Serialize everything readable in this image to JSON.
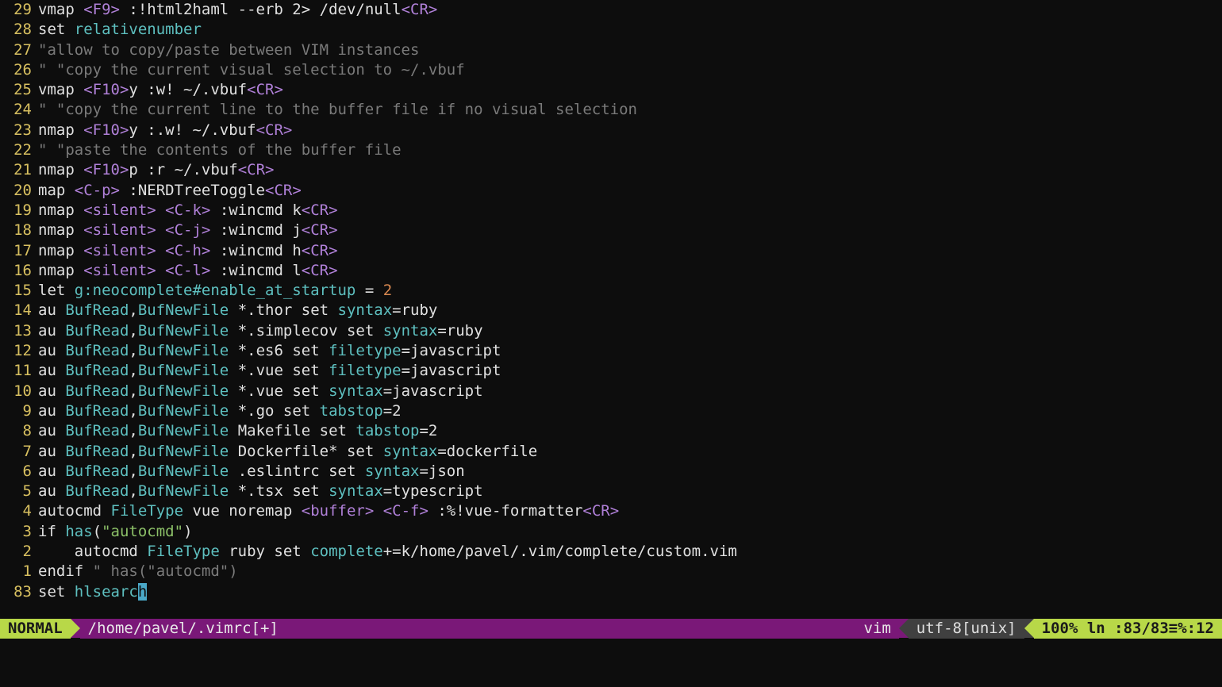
{
  "lines": [
    {
      "n": "29",
      "html": "vmap <span class='purple'>&lt;F9&gt;</span> :!html2haml --erb 2&gt; /dev/null<span class='purple'>&lt;CR&gt;</span>"
    },
    {
      "n": "28",
      "html": "set <span class='cyan'>relativenumber</span>"
    },
    {
      "n": "27",
      "html": "<span class='gray'>\"allow to copy/paste between VIM instances</span>"
    },
    {
      "n": "26",
      "html": "<span class='gray'>\" \"copy the current visual selection to ~/.vbuf</span>"
    },
    {
      "n": "25",
      "html": "vmap <span class='purple'>&lt;F10&gt;</span>y :w! ~/.vbuf<span class='purple'>&lt;CR&gt;</span>"
    },
    {
      "n": "24",
      "html": "<span class='gray'>\" \"copy the current line to the buffer file if no visual selection</span>"
    },
    {
      "n": "23",
      "html": "nmap <span class='purple'>&lt;F10&gt;</span>y :.w! ~/.vbuf<span class='purple'>&lt;CR&gt;</span>"
    },
    {
      "n": "22",
      "html": "<span class='gray'>\" \"paste the contents of the buffer file</span>"
    },
    {
      "n": "21",
      "html": "nmap <span class='purple'>&lt;F10&gt;</span>p :r ~/.vbuf<span class='purple'>&lt;CR&gt;</span>"
    },
    {
      "n": "20",
      "html": "map <span class='purple'>&lt;C-p&gt;</span> :NERDTreeToggle<span class='purple'>&lt;CR&gt;</span>"
    },
    {
      "n": "19",
      "html": "nmap <span class='purple'>&lt;silent&gt;</span> <span class='purple'>&lt;C-k&gt;</span> :wincmd k<span class='purple'>&lt;CR&gt;</span>"
    },
    {
      "n": "18",
      "html": "nmap <span class='purple'>&lt;silent&gt;</span> <span class='purple'>&lt;C-j&gt;</span> :wincmd j<span class='purple'>&lt;CR&gt;</span>"
    },
    {
      "n": "17",
      "html": "nmap <span class='purple'>&lt;silent&gt;</span> <span class='purple'>&lt;C-h&gt;</span> :wincmd h<span class='purple'>&lt;CR&gt;</span>"
    },
    {
      "n": "16",
      "html": "nmap <span class='purple'>&lt;silent&gt;</span> <span class='purple'>&lt;C-l&gt;</span> :wincmd l<span class='purple'>&lt;CR&gt;</span>"
    },
    {
      "n": "15",
      "html": "let <span class='cyan'>g:neocomplete#enable_at_startup</span> = <span class='orange'>2</span>"
    },
    {
      "n": "14",
      "html": "au <span class='cyan'>BufRead</span>,<span class='cyan'>BufNewFile</span> *.thor set <span class='cyan'>syntax</span>=ruby"
    },
    {
      "n": "13",
      "html": "au <span class='cyan'>BufRead</span>,<span class='cyan'>BufNewFile</span> *.simplecov set <span class='cyan'>syntax</span>=ruby"
    },
    {
      "n": "12",
      "html": "au <span class='cyan'>BufRead</span>,<span class='cyan'>BufNewFile</span> *.es6 set <span class='cyan'>filetype</span>=javascript"
    },
    {
      "n": "11",
      "html": "au <span class='cyan'>BufRead</span>,<span class='cyan'>BufNewFile</span> *.vue set <span class='cyan'>filetype</span>=javascript"
    },
    {
      "n": "10",
      "html": "au <span class='cyan'>BufRead</span>,<span class='cyan'>BufNewFile</span> *.vue set <span class='cyan'>syntax</span>=javascript"
    },
    {
      "n": "9",
      "html": "au <span class='cyan'>BufRead</span>,<span class='cyan'>BufNewFile</span> *.go set <span class='cyan'>tabstop</span>=2"
    },
    {
      "n": "8",
      "html": "au <span class='cyan'>BufRead</span>,<span class='cyan'>BufNewFile</span> Makefile set <span class='cyan'>tabstop</span>=2"
    },
    {
      "n": "7",
      "html": "au <span class='cyan'>BufRead</span>,<span class='cyan'>BufNewFile</span> Dockerfile* set <span class='cyan'>syntax</span>=dockerfile"
    },
    {
      "n": "6",
      "html": "au <span class='cyan'>BufRead</span>,<span class='cyan'>BufNewFile</span> .eslintrc set <span class='cyan'>syntax</span>=json"
    },
    {
      "n": "5",
      "html": "au <span class='cyan'>BufRead</span>,<span class='cyan'>BufNewFile</span> *.tsx set <span class='cyan'>syntax</span>=typescript"
    },
    {
      "n": "4",
      "html": "autocmd <span class='cyan'>FileType</span> vue noremap <span class='purple'>&lt;buffer&gt;</span> <span class='purple'>&lt;C-f&gt;</span> :%!vue-formatter<span class='purple'>&lt;CR&gt;</span>"
    },
    {
      "n": "3",
      "html": "if <span class='cyan'>has</span>(<span class='green'>\"autocmd\"</span>)"
    },
    {
      "n": "2",
      "html": "    autocmd <span class='cyan'>FileType</span> ruby set <span class='cyan'>complete</span>+=k/home/pavel/.vim/complete/custom.vim"
    },
    {
      "n": "1",
      "html": "endif <span class='gray'>\" has(\"autocmd\")</span>"
    },
    {
      "n": "83",
      "html": "set <span class='cyan'>hlsearc</span><span class='cursor'>h</span>",
      "abs": true
    }
  ],
  "status": {
    "mode": "NORMAL",
    "file": "/home/pavel/.vimrc[+]",
    "filetype": "vim",
    "encoding": "utf-8[unix]",
    "percent": "100%",
    "lineinfo": "ln :83/83≡%:12"
  }
}
